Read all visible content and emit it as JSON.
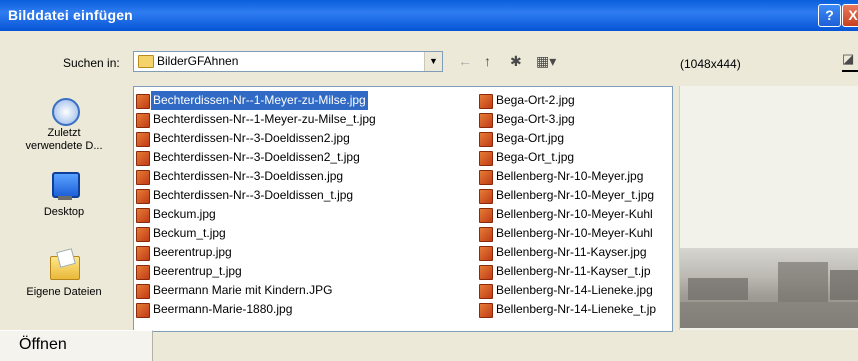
{
  "window": {
    "title": "Bilddatei einfügen",
    "help_glyph": "?",
    "close_glyph": "X"
  },
  "toolbar": {
    "lookin_label": "Suchen in:",
    "folder": "BilderGFAhnen",
    "back_glyph": "←",
    "up_glyph": "↑",
    "newfolder_glyph": "✱",
    "views_glyph": "▦▾",
    "dropdown_glyph": "▼"
  },
  "places": [
    {
      "label": "Zuletzt verwendete D...",
      "icon": "recent-documents-icon"
    },
    {
      "label": "Desktop",
      "icon": "desktop-icon"
    },
    {
      "label": "Eigene Dateien",
      "icon": "my-documents-icon"
    }
  ],
  "files": {
    "col1": [
      "Bechterdissen-Nr--1-Meyer-zu-Milse.jpg",
      "Bechterdissen-Nr--1-Meyer-zu-Milse_t.jpg",
      "Bechterdissen-Nr--3-Doeldissen2.jpg",
      "Bechterdissen-Nr--3-Doeldissen2_t.jpg",
      "Bechterdissen-Nr--3-Doeldissen.jpg",
      "Bechterdissen-Nr--3-Doeldissen_t.jpg",
      "Beckum.jpg",
      "Beckum_t.jpg",
      "Beerentrup.jpg",
      "Beerentrup_t.jpg",
      "Beermann Marie mit Kindern.JPG",
      "Beermann-Marie-1880.jpg"
    ],
    "col2": [
      "Bega-Ort-2.jpg",
      "Bega-Ort-3.jpg",
      "Bega-Ort.jpg",
      "Bega-Ort_t.jpg",
      "Bellenberg-Nr-10-Meyer.jpg",
      "Bellenberg-Nr-10-Meyer_t.jpg",
      "Bellenberg-Nr-10-Meyer-Kuhl",
      "Bellenberg-Nr-10-Meyer-Kuhl",
      "Bellenberg-Nr-11-Kayser.jpg",
      "Bellenberg-Nr-11-Kayser_t.jp",
      "Bellenberg-Nr-14-Lieneke.jpg",
      "Bellenberg-Nr-14-Lieneke_t.jp"
    ],
    "selected": "Bechterdissen-Nr--1-Meyer-zu-Milse.jpg"
  },
  "preview": {
    "dimensions": "(1048x444)"
  },
  "open_button": {
    "label": "Öffnen"
  },
  "colors": {
    "titlebar": "#0a5fdb",
    "selection": "#316ac5",
    "dialog_bg": "#ece9d8"
  }
}
